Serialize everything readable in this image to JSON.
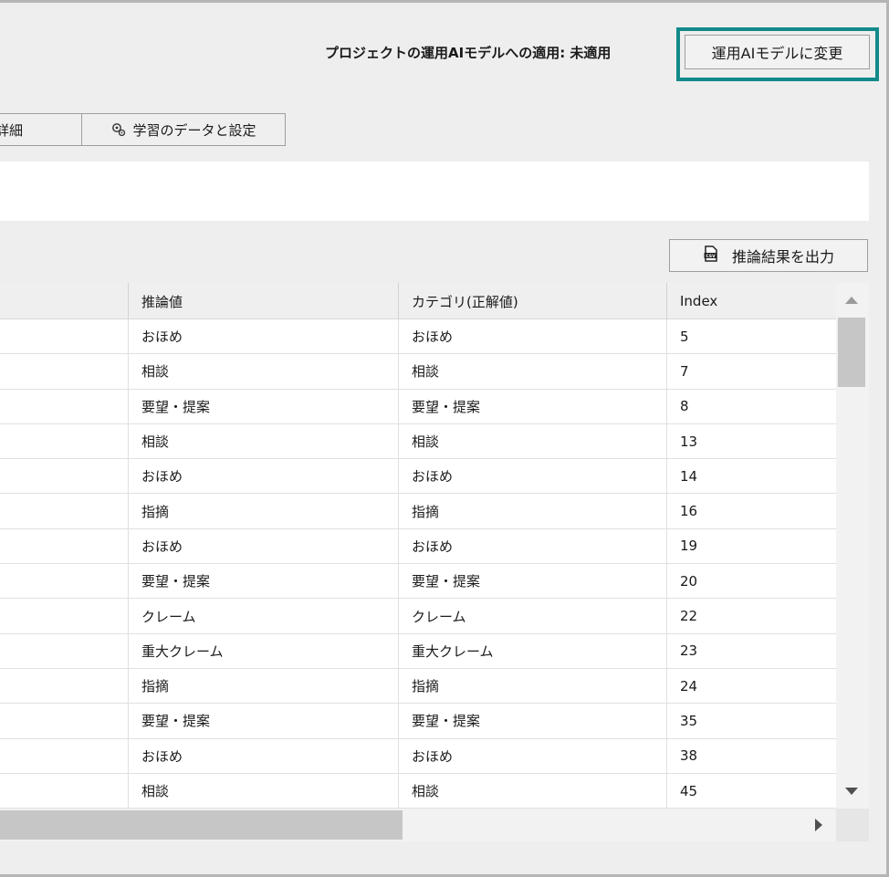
{
  "header": {
    "apply_status": "プロジェクトの運用AIモデルへの適用: 未適用",
    "apply_button_label": "運用AIモデルに変更"
  },
  "tabs": {
    "partial_label": "詳細",
    "training_label": "学習のデータと設定"
  },
  "toolbar": {
    "export_label": "推論結果を出力"
  },
  "table": {
    "columns": [
      "推論値",
      "カテゴリ(正解値)",
      "Index"
    ],
    "rows": [
      {
        "inferred": "おほめ",
        "category": "おほめ",
        "index": "5"
      },
      {
        "inferred": "相談",
        "category": "相談",
        "index": "7"
      },
      {
        "inferred": "要望・提案",
        "category": "要望・提案",
        "index": "8"
      },
      {
        "inferred": "相談",
        "category": "相談",
        "index": "13"
      },
      {
        "inferred": "おほめ",
        "category": "おほめ",
        "index": "14"
      },
      {
        "inferred": "指摘",
        "category": "指摘",
        "index": "16"
      },
      {
        "inferred": "おほめ",
        "category": "おほめ",
        "index": "19"
      },
      {
        "inferred": "要望・提案",
        "category": "要望・提案",
        "index": "20"
      },
      {
        "inferred": "クレーム",
        "category": "クレーム",
        "index": "22"
      },
      {
        "inferred": "重大クレーム",
        "category": "重大クレーム",
        "index": "23"
      },
      {
        "inferred": "指摘",
        "category": "指摘",
        "index": "24"
      },
      {
        "inferred": "要望・提案",
        "category": "要望・提案",
        "index": "35"
      },
      {
        "inferred": "おほめ",
        "category": "おほめ",
        "index": "38"
      },
      {
        "inferred": "相談",
        "category": "相談",
        "index": "45"
      }
    ]
  },
  "icons": {
    "training_tab_icon": "gear-icon",
    "export_icon": "csv-file-icon"
  },
  "colors": {
    "highlight": "#138a8a"
  }
}
